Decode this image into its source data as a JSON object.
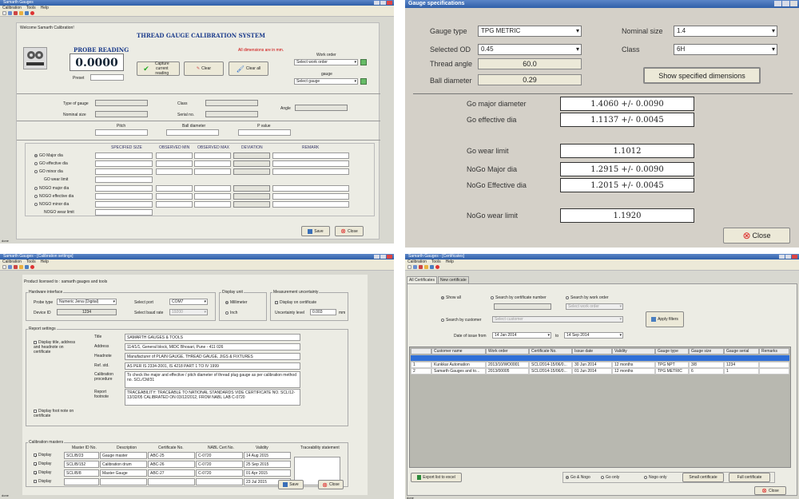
{
  "p1": {
    "title": "Samarth Gauges",
    "menu": [
      "Calibration",
      "Tools",
      "Help"
    ],
    "welcome": "Welcome Samarth Calibration!",
    "heading": "THREAD GAUGE CALIBRATION SYSTEM",
    "dims_note": "All dimensions are in mm.",
    "probe_label": "PROBE READING",
    "probe_value": "0.0000",
    "preset_label": "Preset",
    "capture_label": "Capture current reading",
    "clear_label": "Clear",
    "clear_all_label": "Clear all",
    "work_order_label": "Work order",
    "work_order_value": "Select work order",
    "gauge_label": "gauge",
    "gauge_value": "Select gauge",
    "type_of_gauge": "Type of gauge",
    "nominal_size": "Nominal size",
    "class_label": "Class",
    "serial_no": "Serial no.",
    "angle_label": "Angle",
    "pitch_label": "Pitch",
    "ball_diameter_label": "Ball diameter",
    "p_value_label": "P value",
    "col_headers": [
      "SPECIFIED SIZE",
      "OBSERVED MIN",
      "OBSERVED MAX",
      "DEVIATION",
      "REMARK"
    ],
    "rows_go": [
      "GO Major dia",
      "GO effective dia",
      "GO minor dia",
      "GO wear limit"
    ],
    "rows_nogo": [
      "NOGO major dia",
      "NOGO effective dia",
      "NOGO minor dia",
      "NOGO wear limit"
    ],
    "save_label": "Save",
    "close_label": "Close",
    "status": "done"
  },
  "p2": {
    "title": "Gauge specifications",
    "gauge_type_label": "Gauge type",
    "gauge_type_value": "TPG METRIC",
    "nominal_size_label": "Nominal size",
    "nominal_size_value": "1.4",
    "selected_od_label": "Selected OD",
    "selected_od_value": "0.45",
    "class_label": "Class",
    "class_value": "6H",
    "thread_angle_label": "Thread angle",
    "thread_angle_value": "60.0",
    "ball_diameter_label": "Ball diameter",
    "ball_diameter_value": "0.29",
    "show_dims_label": "Show specified dimensions",
    "results": [
      {
        "label": "Go major diameter",
        "value": "1.4060 +/- 0.0090"
      },
      {
        "label": "Go effective dia",
        "value": "1.1137 +/- 0.0045"
      },
      {
        "label": "Go wear limit",
        "value": "1.1012"
      },
      {
        "label": "NoGo Major dia",
        "value": "1.2915 +/- 0.0090"
      },
      {
        "label": "NoGo Effective dia",
        "value": "1.2015 +/- 0.0045"
      },
      {
        "label": "NoGo wear limit",
        "value": "1.1920"
      }
    ],
    "close_label": "Close"
  },
  "p3": {
    "title": "Samarth Gauges - [Calibration settings]",
    "menu": [
      "Calibration",
      "Tools",
      "Help"
    ],
    "licensed": "Product licensed to : samarth gauges and tools",
    "hw_group": "Hardware interface",
    "probe_type_label": "Probe type",
    "probe_type_value": "Numeric Jena (Digital)",
    "device_id_label": "Device ID",
    "device_id_value": "1234",
    "select_port_label": "Select port",
    "select_port_value": "COM7",
    "baud_label": "Select baud rate",
    "baud_value": "19200",
    "display_unit_group": "Display unit",
    "unit_mm": "Millimeter",
    "unit_inch": "Inch",
    "mu_group": "Measurement uncertainty",
    "mu_display": "Display on certificate",
    "mu_level_label": "Uncertainty level",
    "mu_level_value": "0.003",
    "mu_unit": "mm",
    "report_group": "Report settings",
    "display_title_label": "Display title, address and headnote on certificate",
    "title_label": "Title",
    "title_value": "SAMARTH GAUGES & TOOLS",
    "address_label": "Address",
    "address_value": "114/1/1, General block, MIDC Bhosari, Pune - 411 026",
    "headnote_label": "Headnote",
    "headnote_value": "Manufacturer of PLAIN GAUGE, THREAD GAUGE, JIGS & FIXTURES",
    "ref_std_label": "Ref. std.",
    "ref_std_value": "AS PER IS 2334-2001, IS 4218 PART 1 TO IV 1999",
    "cal_proc_label": "Calibration procedure",
    "cal_proc_value": "To check the major and effective / pitch diameter of thread plug gauge as per calibration method no. SCL/CM/31",
    "display_foot_label": "Display foot note on certificate",
    "report_foot_label": "Report footnote",
    "report_foot_value": "TRACEABILITY: TRACEABLE TO NATIONAL STANDARDS VIDE CERTIFICATE NO. SCL/12-13/32/05 CALIBRATED ON 03/12/2012, FROM NABL LAB C-0720",
    "cal_masters_group": "Calibration masters",
    "master_headers": [
      "Master ID No.",
      "Description",
      "Certificate No.",
      "NABL Cert No.",
      "Validity",
      "Traceability statement"
    ],
    "display_word": "Display",
    "masters": [
      {
        "id": "SCL/B/23",
        "desc": "Gauge master",
        "cert": "ABC-25",
        "nabl": "C-0720",
        "validity": "14 Aug 2015",
        "checked": true
      },
      {
        "id": "SCL/B/152",
        "desc": "Calibration drum",
        "cert": "ABC-26",
        "nabl": "C-0720",
        "validity": "25 Sep 2015",
        "checked": true
      },
      {
        "id": "SCL/B/8",
        "desc": "Master Gauge",
        "cert": "ABC-27",
        "nabl": "C-0720",
        "validity": "01 Apr 2015",
        "checked": true
      },
      {
        "id": "",
        "desc": "",
        "cert": "",
        "nabl": "",
        "validity": "23 Jul 2015",
        "checked": false
      }
    ],
    "save_label": "Save",
    "close_label": "Close",
    "status": "done"
  },
  "p4": {
    "title": "Samarth Gauges - [Certificates]",
    "menu": [
      "Calibration",
      "Tools",
      "Help"
    ],
    "tabs": [
      "All Certificates",
      "New certificate"
    ],
    "show_all": "Show all",
    "search_cert": "Search by certificate number",
    "search_wo": "Search by work order",
    "wo_placeholder": "Select work order",
    "search_customer": "Search by customer",
    "customer_placeholder": "Select customer",
    "date_label": "Date of issue from",
    "date_from": "14 Jan 2014",
    "to_label": "to",
    "date_to": "14 Sep 2014",
    "apply_label": "Apply filters",
    "headers": [
      "",
      "Customer name",
      "Work order",
      "Certificate No.",
      "Issue date",
      "Validity",
      "Gauge type",
      "Gauge size",
      "Gauge serial",
      "Remarks"
    ],
    "rows": [
      [
        "1",
        "Kunkkar Automation",
        "2013/10/WO0001",
        "SCL/2014-15/06/0...",
        "30 Jun 2014",
        "12 months",
        "TPG NPT",
        "3/8",
        "1234",
        ""
      ],
      [
        "2",
        "Samarth Gauges and to...",
        "2013/00005",
        "SCL/2014-15/06/0...",
        "01 Jun 2014",
        "12 months",
        "TPG METRIC",
        "6",
        "1",
        ""
      ]
    ],
    "export_label": "Export list to excel",
    "go_nogo": "Go & Nogo",
    "go_only": "Go only",
    "nogo_only": "Nogo only",
    "small_cert": "Small certificate",
    "full_cert": "Full certificate",
    "close_label": "Close",
    "status": "done"
  }
}
